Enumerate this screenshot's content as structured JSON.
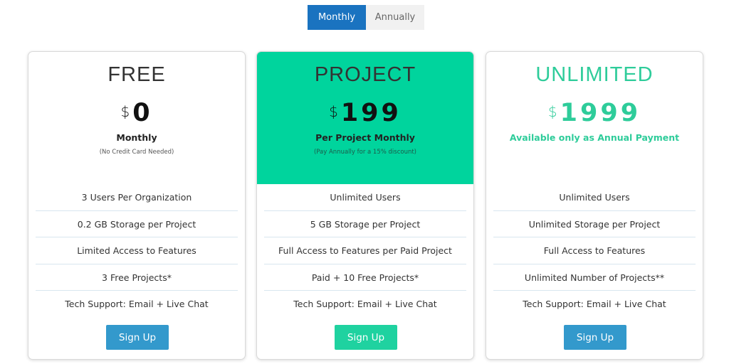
{
  "toggle": {
    "monthly": "Monthly",
    "annually": "Annually"
  },
  "plans": [
    {
      "name": "FREE",
      "currency": "$",
      "price": "0",
      "period": "Monthly",
      "note": "(No Credit Card Needed)",
      "features": [
        "3 Users Per Organization",
        "0.2 GB Storage per Project",
        "Limited Access to Features",
        "3 Free Projects*",
        "Tech Support: Email + Live Chat"
      ],
      "signup": "Sign Up"
    },
    {
      "name": "PROJECT",
      "currency": "$",
      "price": "199",
      "period": "Per Project Monthly",
      "note": "(Pay Annually for a 15% discount)",
      "features": [
        "Unlimited Users",
        "5 GB Storage per Project",
        "Full Access to Features per Paid Project",
        "Paid + 10 Free Projects*",
        "Tech Support: Email + Live Chat"
      ],
      "signup": "Sign Up"
    },
    {
      "name": "UNLIMITED",
      "currency": "$",
      "price": "1999",
      "period": "Available only as Annual Payment",
      "note": "",
      "features": [
        "Unlimited Users",
        "Unlimited Storage per Project",
        "Full Access to Features",
        "Unlimited Number of Projects**",
        "Tech Support: Email + Live Chat"
      ],
      "signup": "Sign Up"
    }
  ],
  "colors": {
    "accent_blue": "#1a73c0",
    "button_blue": "#3399cc",
    "accent_green": "#00d49d",
    "text_green": "#2ecc9a"
  }
}
